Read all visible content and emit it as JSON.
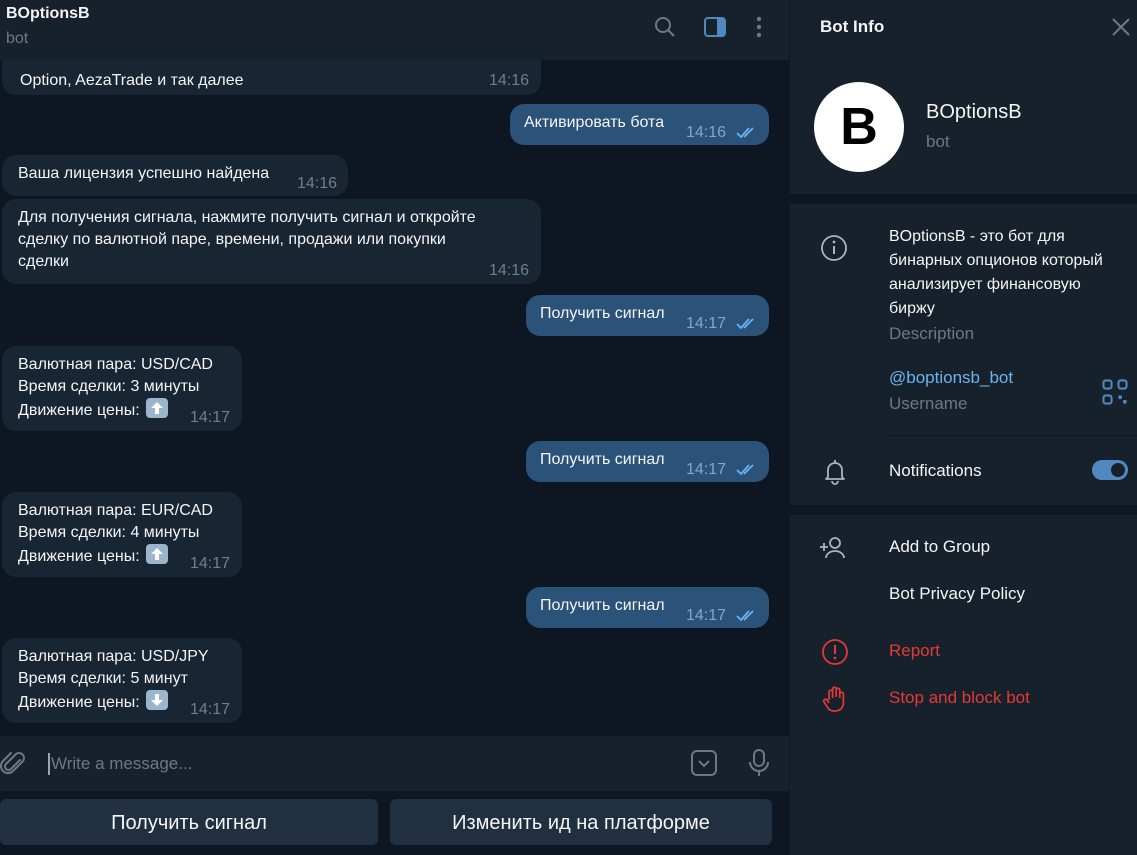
{
  "header": {
    "title": "BOptionsB",
    "subtitle": "bot"
  },
  "messages": {
    "m0_line1": "Option, AezaTrade и так далее",
    "m0_time": "14:16",
    "m1_text": "Активировать бота",
    "m1_time": "14:16",
    "m2_text": "Ваша лицензия успешно найдена",
    "m2_time": "14:16",
    "m3_line1": "Для получения сигнала, нажмите получить сигнал и откройте",
    "m3_line2": "сделку по валютной паре, времени, продажи или покупки",
    "m3_line3": "сделки",
    "m3_time": "14:16",
    "m4_text": "Получить сигнал",
    "m4_time": "14:17",
    "m5_line1": "Валютная пара: USD/CAD",
    "m5_line2": "Время сделки: 3 минуты",
    "m5_line3": "Движение цены:",
    "m5_time": "14:17",
    "m6_text": "Получить сигнал",
    "m6_time": "14:17",
    "m7_line1": "Валютная пара: EUR/CAD",
    "m7_line2": "Время сделки: 4 минуты",
    "m7_line3": "Движение цены:",
    "m7_time": "14:17",
    "m8_text": "Получить сигнал",
    "m8_time": "14:17",
    "m9_line1": "Валютная пара: USD/JPY",
    "m9_line2": "Время сделки: 5 минут",
    "m9_line3": "Движение цены:",
    "m9_time": "14:17"
  },
  "input": {
    "placeholder": "Write a message..."
  },
  "keyboard": {
    "btn1": "Получить сигнал",
    "btn2": "Изменить ид на платформе"
  },
  "panel": {
    "title": "Bot Info",
    "avatar_letter": "B",
    "name": "BOptionsB",
    "sub": "bot",
    "description": "BOptionsB - это бот для бинарных опционов который анализирует финансовую биржу",
    "description_label": "Description",
    "username": "@boptionsb_bot",
    "username_label": "Username",
    "notifications": "Notifications",
    "notifications_on": true,
    "add_to_group": "Add to Group",
    "privacy": "Bot Privacy Policy",
    "report": "Report",
    "stop": "Stop and block bot"
  },
  "colors": {
    "accent": "#5288c1",
    "link": "#6ab3f3",
    "danger": "#e53935",
    "outgoing_bubble": "#2b5278",
    "incoming_bubble": "#182533"
  }
}
